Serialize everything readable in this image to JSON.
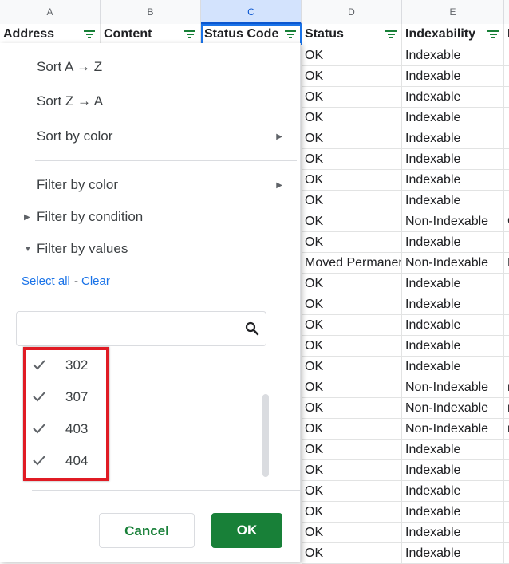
{
  "columns": [
    {
      "letter": "A",
      "header": "Address"
    },
    {
      "letter": "B",
      "header": "Content"
    },
    {
      "letter": "C",
      "header": "Status Code"
    },
    {
      "letter": "D",
      "header": "Status"
    },
    {
      "letter": "E",
      "header": "Indexability"
    },
    {
      "letter": "",
      "header": "I"
    }
  ],
  "rows": [
    {
      "status": "OK",
      "indexability": "Indexable",
      "extra": ""
    },
    {
      "status": "OK",
      "indexability": "Indexable",
      "extra": ""
    },
    {
      "status": "OK",
      "indexability": "Indexable",
      "extra": ""
    },
    {
      "status": "OK",
      "indexability": "Indexable",
      "extra": ""
    },
    {
      "status": "OK",
      "indexability": "Indexable",
      "extra": ""
    },
    {
      "status": "OK",
      "indexability": "Indexable",
      "extra": ""
    },
    {
      "status": "OK",
      "indexability": "Indexable",
      "extra": ""
    },
    {
      "status": "OK",
      "indexability": "Indexable",
      "extra": ""
    },
    {
      "status": "OK",
      "indexability": "Non-Indexable",
      "extra": "C"
    },
    {
      "status": "OK",
      "indexability": "Indexable",
      "extra": ""
    },
    {
      "status": "Moved Permanently",
      "indexability": "Non-Indexable",
      "extra": "R"
    },
    {
      "status": "OK",
      "indexability": "Indexable",
      "extra": ""
    },
    {
      "status": "OK",
      "indexability": "Indexable",
      "extra": ""
    },
    {
      "status": "OK",
      "indexability": "Indexable",
      "extra": ""
    },
    {
      "status": "OK",
      "indexability": "Indexable",
      "extra": ""
    },
    {
      "status": "OK",
      "indexability": "Indexable",
      "extra": ""
    },
    {
      "status": "OK",
      "indexability": "Non-Indexable",
      "extra": "n"
    },
    {
      "status": "OK",
      "indexability": "Non-Indexable",
      "extra": "n"
    },
    {
      "status": "OK",
      "indexability": "Non-Indexable",
      "extra": "n"
    },
    {
      "status": "OK",
      "indexability": "Indexable",
      "extra": ""
    },
    {
      "status": "OK",
      "indexability": "Indexable",
      "extra": ""
    },
    {
      "status": "OK",
      "indexability": "Indexable",
      "extra": ""
    },
    {
      "status": "OK",
      "indexability": "Indexable",
      "extra": ""
    },
    {
      "status": "OK",
      "indexability": "Indexable",
      "extra": ""
    },
    {
      "status": "OK",
      "indexability": "Indexable",
      "extra": ""
    }
  ],
  "menu": {
    "sort_az": "Sort A → Z",
    "sort_za": "Sort Z → A",
    "sort_by_color": "Sort by color",
    "filter_by_color": "Filter by color",
    "filter_by_condition": "Filter by condition",
    "filter_by_values": "Filter by values",
    "select_all": "Select all",
    "separator": "-",
    "clear": "Clear",
    "search_value": "",
    "values": [
      "302",
      "307",
      "403",
      "404"
    ],
    "cancel": "Cancel",
    "ok": "OK"
  },
  "colors": {
    "accent": "#188038",
    "selection": "#1a73e8",
    "highlight": "#e01b24"
  }
}
